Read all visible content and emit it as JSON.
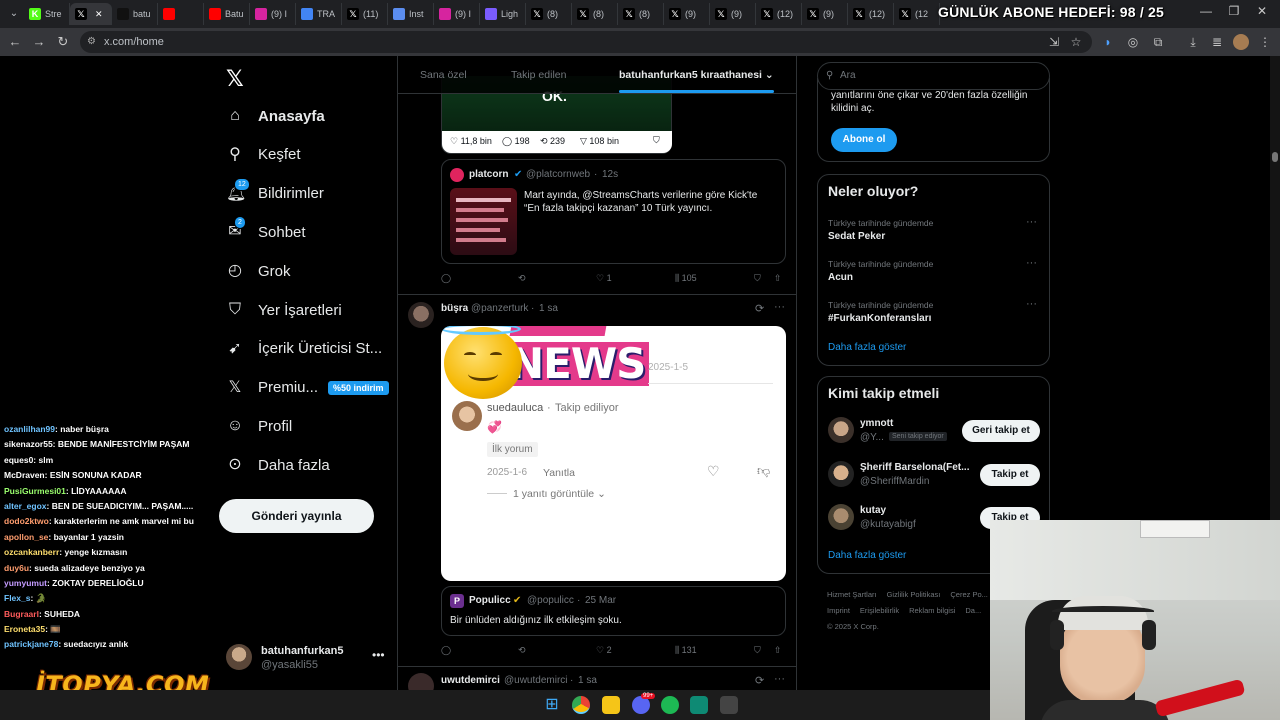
{
  "browser": {
    "tabs": [
      {
        "icon": "kick-icon",
        "label": "Stre",
        "color": "#53fc18",
        "active": false
      },
      {
        "icon": "x-icon",
        "label": "",
        "color": "#000000",
        "active": true
      },
      {
        "icon": "tiktok-icon",
        "label": "batu",
        "color": "#111111",
        "active": false
      },
      {
        "icon": "youtube-icon",
        "label": "",
        "color": "#ff0000",
        "active": false
      },
      {
        "icon": "youtube-icon",
        "label": "Batu",
        "color": "#ff0000",
        "active": false
      },
      {
        "icon": "instagram-icon",
        "label": "(9) I",
        "color": "#d6249f",
        "active": false
      },
      {
        "icon": "chrome-icon",
        "label": "TRA",
        "color": "#4285f4",
        "active": false
      },
      {
        "icon": "x-icon",
        "label": "(11)",
        "color": "#000000",
        "active": false
      },
      {
        "icon": "web-icon",
        "label": "Inst",
        "color": "#5b8def",
        "active": false
      },
      {
        "icon": "instagram-icon",
        "label": "(9) I",
        "color": "#d6249f",
        "active": false
      },
      {
        "icon": "lightning-icon",
        "label": "Ligh",
        "color": "#7b5cff",
        "active": false
      },
      {
        "icon": "x-icon",
        "label": "(8)",
        "color": "#000000",
        "active": false
      },
      {
        "icon": "x-icon",
        "label": "(8)",
        "color": "#000000",
        "active": false
      },
      {
        "icon": "x-icon",
        "label": "(8)",
        "color": "#000000",
        "active": false
      },
      {
        "icon": "x-icon",
        "label": "(9)",
        "color": "#000000",
        "active": false
      },
      {
        "icon": "x-icon",
        "label": "(9)",
        "color": "#000000",
        "active": false
      },
      {
        "icon": "x-icon",
        "label": "(12)",
        "color": "#000000",
        "active": false
      },
      {
        "icon": "x-icon",
        "label": "(9)",
        "color": "#000000",
        "active": false
      },
      {
        "icon": "x-icon",
        "label": "(12)",
        "color": "#000000",
        "active": false
      },
      {
        "icon": "x-icon",
        "label": "(12",
        "color": "#000000",
        "active": false
      }
    ],
    "url": "x.com/home",
    "stream_overlay_goal": "GÜNLÜK ABONE HEDEFİ: 98 / 25"
  },
  "left_nav": {
    "items": [
      {
        "icon": "home-icon",
        "label": "Anasayfa",
        "bold": true,
        "badge": ""
      },
      {
        "icon": "search-icon",
        "label": "Keşfet",
        "bold": false,
        "badge": ""
      },
      {
        "icon": "bell-icon",
        "label": "Bildirimler",
        "bold": false,
        "badge": "12"
      },
      {
        "icon": "chat-icon",
        "label": "Sohbet",
        "bold": false,
        "badge": "2"
      },
      {
        "icon": "grok-icon",
        "label": "Grok",
        "bold": false,
        "badge": ""
      },
      {
        "icon": "bookmark-icon",
        "label": "Yer İşaretleri",
        "bold": false,
        "badge": ""
      },
      {
        "icon": "rocket-icon",
        "label": "İçerik Üreticisi St...",
        "bold": false,
        "badge": ""
      },
      {
        "icon": "x-premium-icon",
        "label": "Premiu...",
        "bold": false,
        "badge": ""
      },
      {
        "icon": "person-icon",
        "label": "Profil",
        "bold": false,
        "badge": ""
      },
      {
        "icon": "more-circle-icon",
        "label": "Daha fazla",
        "bold": false,
        "badge": ""
      }
    ],
    "premium_promo": "%50 indirim",
    "post_button": "Gönderi yayınla",
    "account": {
      "name": "batuhanfurkan5",
      "handle": "@yasakli55",
      "more": "•••"
    }
  },
  "feed": {
    "tabs": [
      "Sana özel",
      "Takip edilen",
      "batuhanfurkan5 kıraathanesi"
    ],
    "active_tab": 2,
    "tweet1": {
      "media_caption": "OK.",
      "media_stats": {
        "likes": "11,8 bin",
        "replies": "198",
        "reposts": "239",
        "views": "108 bin"
      },
      "quote": {
        "name": "platcorn",
        "handle": "@platcornweb",
        "time": "12s",
        "text": "Mart ayında, @StreamsCharts verilerine göre Kick'te “En fazla takipçi kazanan” 10 Türk yayıncı."
      },
      "stats": {
        "reposts": "",
        "likes": "1",
        "views": "105"
      }
    },
    "tweet2": {
      "name": "büşra",
      "handle": "@panzerturk",
      "time": "1 sa",
      "media": {
        "headline": "NEWS",
        "date": "2025-1-5",
        "comment_user": "suedauluca",
        "following": "Takip ediliyor",
        "comment_emoji": "💞",
        "tag": "İlk yorum",
        "comment_date": "2025-1-6",
        "reply": "Yanıtla",
        "see_replies": "1 yanıtı görüntüle"
      },
      "quote": {
        "name": "Populicc",
        "handle": "@populicc",
        "time": "25 Mar",
        "text": "Bir ünlüden aldığınız ilk etkileşim şoku."
      },
      "stats": {
        "likes": "2",
        "views": "131"
      }
    },
    "tweet3": {
      "name": "uwutdemirci",
      "handle": "@uwutdemirci",
      "time": "1 sa"
    }
  },
  "right": {
    "search_placeholder": "Ara",
    "premium_text_line1": "yanıtlarını öne çıkar ve 20'den fazla özelliğin",
    "premium_text_line2": "kilidini aç.",
    "subscribe_button": "Abone ol",
    "trends_title": "Neler oluyor?",
    "trends": [
      {
        "meta": "Türkiye tarihinde gündemde",
        "name": "Sedat Peker"
      },
      {
        "meta": "Türkiye tarihinde gündemde",
        "name": "Acun"
      },
      {
        "meta": "Türkiye tarihinde gündemde",
        "name": "#FurkanKonferansları"
      }
    ],
    "show_more": "Daha fazla göster",
    "who_to_follow_title": "Kimi takip etmeli",
    "who_to_follow": [
      {
        "name": "ymnott",
        "handle": "@Y...",
        "follows_you": "Seni takip ediyor",
        "button": "Geri takip et"
      },
      {
        "name": "Şheriff Barselona(Fet...",
        "handle": "@SheriffMardin",
        "follows_you": "",
        "button": "Takip et"
      },
      {
        "name": "kutay",
        "handle": "@kutayabigf",
        "follows_you": "",
        "button": "Takip et"
      }
    ],
    "footer": [
      "Hizmet Şartları",
      "Gizlilik Politikası",
      "Çerez Po...",
      "Imprint",
      "Erişilebilirlik",
      "Reklam bilgisi",
      "Da...",
      "© 2025 X Corp."
    ]
  },
  "chat": {
    "lines": [
      {
        "user": "ozanlilhan99",
        "msg": ": naber büşra",
        "color": "#6fc3ff"
      },
      {
        "user": "sikenazor55",
        "msg": ": BENDE MANİFESTCİYİM PAŞAM",
        "color": "#ffffff"
      },
      {
        "user": "eques0",
        "msg": ": slm",
        "color": "#ffffff"
      },
      {
        "user": "McDraven",
        "msg": ": ESİN SONUNA KADAR",
        "color": "#ffffff"
      },
      {
        "user": "PusiGurmesi01",
        "msg": ": LİDYAAAAAA",
        "color": "#9bff6e"
      },
      {
        "user": "alter_egox",
        "msg": ": BEN DE SUEADICIYIM... PAŞAM.....",
        "color": "#6fc3ff"
      },
      {
        "user": "dodo2ktwo",
        "msg": ": karakterlerim ne amk marvel mi bu",
        "color": "#ff9d6e"
      },
      {
        "user": "apollon_se",
        "msg": ": bayanlar 1 yazsin",
        "color": "#ff9d6e"
      },
      {
        "user": "ozcankanberr",
        "msg": ": yenge kızmasın",
        "color": "#ffdf6e"
      },
      {
        "user": "duy6u",
        "msg": ": sueda alizadeye benziyo ya",
        "color": "#ff9d6e"
      },
      {
        "user": "yumyumut",
        "msg": ": ZOKTAY DERELİOĞLU",
        "color": "#c49bff"
      },
      {
        "user": "Flex_s",
        "msg": ": 🐊",
        "color": "#6fc3ff"
      },
      {
        "user": "Bugraarl",
        "msg": ": SUHEDA",
        "color": "#ff5c5c"
      },
      {
        "user": "Eroneta35",
        "msg": ": 🎞️",
        "color": "#ffdf6e"
      },
      {
        "user": "patrickjane78",
        "msg": ": suedacıyız anlık",
        "color": "#6fc3ff"
      }
    ],
    "sponsor": "İTOPYA.COM"
  },
  "taskbar": {
    "items": [
      "windows-icon",
      "chrome-icon",
      "folder-icon",
      "discord-icon",
      "spotify-icon",
      "app-icon",
      "store-icon"
    ],
    "discord_badge": "99+"
  }
}
